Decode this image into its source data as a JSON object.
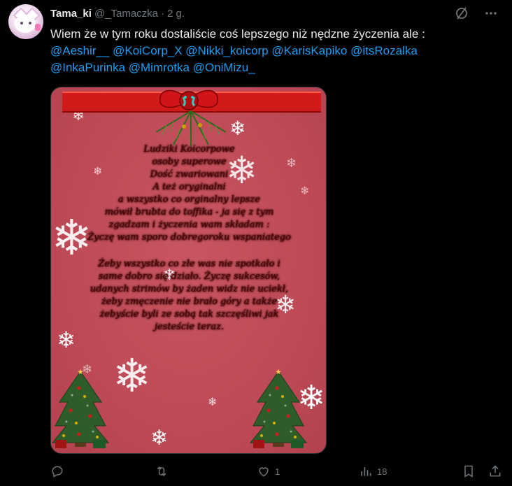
{
  "author": {
    "name": "Tama_ki",
    "handle": "@_Tamaczka",
    "separator": "·",
    "time": "2 g."
  },
  "tweet_text": {
    "line1": "Wiem że w tym roku dostaliście coś lepszego niż nędzne życzenia ale :",
    "mentions_row1": [
      "@Aeshir__",
      "@KoiCorp_X",
      "@Nikki_koicorp",
      "@KarisKapiko",
      "@itsRozalka"
    ],
    "mentions_row2": [
      "@InkaPurinka",
      "@Mimrotka",
      "@OniMizu_"
    ]
  },
  "image": {
    "poem_stanza1": [
      "Ludziki Koicorpowe",
      "osoby superowe",
      "Dość zwariowani",
      "A też oryginalni",
      "a wszystko co orginalny lepsze",
      "mówił brubta do toffika - ja się z tym",
      "zgadzam i życzenia wam składam :",
      "Życzę wam sporo dobregoroku wspaniatego"
    ],
    "poem_stanza2": [
      "Żeby wszystko co złe was nie spotkało i",
      "same dobro się działo. Życzę sukcesów,",
      "udanych strimów by żaden widz nie uciekł,",
      "żeby zmęczenie nie brało góry a także",
      "żebyście byli ze sobą tak szczęśliwi jak",
      "jesteście teraz."
    ]
  },
  "actions": {
    "reply_count": "",
    "retweet_count": "",
    "like_count": "1",
    "views_count": "18"
  },
  "colors": {
    "background": "#000000",
    "mention": "#1d9bf0",
    "muted": "#71767b",
    "card_red": "#c14e5b"
  },
  "icons": [
    "grok-icon",
    "more-icon",
    "reply-icon",
    "retweet-icon",
    "like-icon",
    "views-icon",
    "bookmark-icon",
    "share-icon"
  ]
}
